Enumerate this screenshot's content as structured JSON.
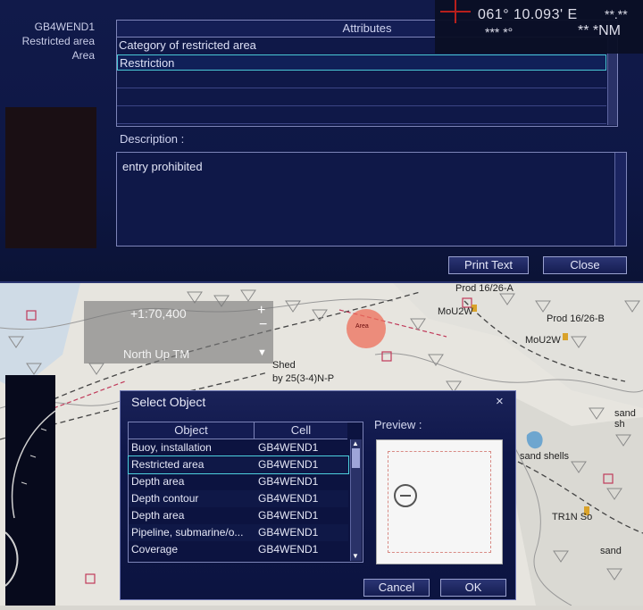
{
  "info_panel": {
    "object_lines": [
      "GB4WEND1",
      "Restricted area",
      "Area"
    ],
    "attributes_header": "Attributes",
    "attribute_rows": [
      "Category of restricted area",
      "Restriction",
      "",
      "",
      ""
    ],
    "description_label": "Description :",
    "description_text": "entry prohibited",
    "print_button": "Print Text",
    "close_button": "Close"
  },
  "position_readout": {
    "longitude": "061° 10.093' E",
    "line2_left": "*** *°",
    "line2_right": "** *NM",
    "line1_extra": "**.**"
  },
  "chart_overlay": {
    "scale": "+1:70,400",
    "orientation": "North Up TM",
    "zoom_in": "+",
    "zoom_out": "−",
    "labels": [
      "Prod 16/26-A",
      "Prod 16/26-B",
      "MoU2W",
      "MoU2W",
      "sand shells",
      "sand sh",
      "sand",
      "Shed",
      "by 25(3-4)N-P",
      "TR1N So",
      "Area"
    ]
  },
  "select_dialog": {
    "title": "Select Object",
    "close_glyph": "×",
    "column_object": "Object",
    "column_cell": "Cell",
    "rows": [
      {
        "object": "Buoy, installation",
        "cell": "GB4WEND1"
      },
      {
        "object": "Restricted area",
        "cell": "GB4WEND1"
      },
      {
        "object": "Depth area",
        "cell": "GB4WEND1"
      },
      {
        "object": "Depth contour",
        "cell": "GB4WEND1"
      },
      {
        "object": "Depth area",
        "cell": "GB4WEND1"
      },
      {
        "object": "Pipeline, submarine/o...",
        "cell": "GB4WEND1"
      },
      {
        "object": "Coverage",
        "cell": "GB4WEND1"
      }
    ],
    "selected_index": 1,
    "preview_label": "Preview :",
    "cancel_button": "Cancel",
    "ok_button": "OK"
  },
  "colors": {
    "panel_bg": "#0e1745",
    "selection_border": "#4dd0de",
    "chart_bg": "#e7e5df",
    "restricted_mark": "#ed6e5a"
  }
}
